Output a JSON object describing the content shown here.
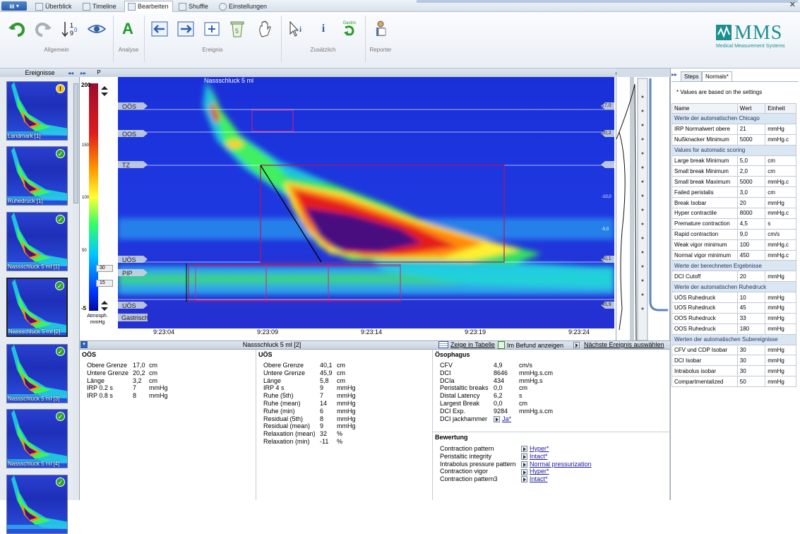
{
  "tabs": [
    "Überblick",
    "Timeline",
    "Bearbeiten",
    "Shuffle",
    "Einstellungen"
  ],
  "active_tab": "Bearbeiten",
  "ribbon": {
    "groups": [
      "Allgemein",
      "Analyse",
      "Ereignis",
      "Zusätzlich",
      "Reporter"
    ],
    "analyse_letter": "A",
    "info_letter": "i",
    "gastric_label": "Gastric"
  },
  "logo": {
    "text": "MMS",
    "subtitle": "Medical Measurement Systems"
  },
  "left_panel": {
    "title": "Ereignisse",
    "thumbs": [
      {
        "label": "Landmark [1]",
        "status": "warn"
      },
      {
        "label": "Ruhedruck [1]",
        "status": "ok"
      },
      {
        "label": "Nassschluck 5 ml [1]",
        "status": "ok"
      },
      {
        "label": "Nassschluck 5 ml [2]",
        "status": "ok"
      },
      {
        "label": "Nassschluck 5 ml [3]",
        "status": "ok"
      },
      {
        "label": "Nassschluck 5 ml [4]",
        "status": "ok"
      },
      {
        "label": "",
        "status": "ok"
      }
    ]
  },
  "colorbar": {
    "header": "P",
    "ticks": [
      "200",
      "150",
      "100",
      "50",
      "0",
      "-5"
    ],
    "unit_line1": "Atmosph.",
    "unit_line2": "mmHg",
    "markers": [
      "30",
      "15"
    ]
  },
  "heatmap": {
    "event_label": "Nassschluck 5 ml",
    "channel_labels": [
      "OÖS",
      "OOS",
      "TZ",
      "UÖS",
      "PIP",
      "UÖS",
      "Gastrisch"
    ],
    "right_values": [
      "17,0",
      "20,2",
      "-10,0",
      "-5,0",
      "40,1",
      "45,9"
    ],
    "time_ticks": [
      "9:23:04",
      "9:23:09",
      "9:23:14",
      "9:23:19",
      "9:23:24"
    ]
  },
  "section_header": {
    "title": "Nassschluck 5 ml [2]",
    "link_table": "Zeige in Tabelle",
    "link_befund": "Im Befund anzeigen",
    "link_next": "Nächste Ereignis auswählen"
  },
  "oos": {
    "title": "OÖS",
    "rows": [
      {
        "label": "Obere Grenze",
        "value": "17,0",
        "unit": "cm"
      },
      {
        "label": "Untere Grenze",
        "value": "20,2",
        "unit": "cm"
      },
      {
        "label": "Länge",
        "value": "3,2",
        "unit": "cm"
      },
      {
        "label": "IRP 0.2 s",
        "value": "7",
        "unit": "mmHg"
      },
      {
        "label": "IRP 0.8 s",
        "value": "8",
        "unit": "mmHg"
      }
    ]
  },
  "uos": {
    "title": "UÖS",
    "rows": [
      {
        "label": "Obere Grenze",
        "value": "40,1",
        "unit": "cm"
      },
      {
        "label": "Untere Grenze",
        "value": "45,9",
        "unit": "cm"
      },
      {
        "label": "Länge",
        "value": "5,8",
        "unit": "cm"
      },
      {
        "label": "IRP 4 s",
        "value": "9",
        "unit": "mmHg"
      },
      {
        "label": "Ruhe (5th)",
        "value": "7",
        "unit": "mmHg"
      },
      {
        "label": "Ruhe (mean)",
        "value": "14",
        "unit": "mmHg"
      },
      {
        "label": "Ruhe (min)",
        "value": "6",
        "unit": "mmHg"
      },
      {
        "label": "Residual (5th)",
        "value": "8",
        "unit": "mmHg"
      },
      {
        "label": "Residual (mean)",
        "value": "9",
        "unit": "mmHg"
      },
      {
        "label": "Relaxation (mean)",
        "value": "32",
        "unit": "%"
      },
      {
        "label": "Relaxation (min)",
        "value": "-11",
        "unit": "%"
      }
    ]
  },
  "oesophagus": {
    "title": "Ösophagus",
    "rows": [
      {
        "label": "CFV",
        "value": "4,9",
        "unit": "cm/s"
      },
      {
        "label": "DCI",
        "value": "8646",
        "unit": "mmHg.s.cm"
      },
      {
        "label": "DCIa",
        "value": "434",
        "unit": "mmHg.s"
      },
      {
        "label": "Peristaltic breaks",
        "value": "0,0",
        "unit": "cm"
      },
      {
        "label": "Distal Latency",
        "value": "6,2",
        "unit": "s"
      },
      {
        "label": "Largest Break",
        "value": "0,0",
        "unit": "cm"
      },
      {
        "label": "DCI Exp.",
        "value": "9284",
        "unit": "mmHg.s.cm"
      },
      {
        "label": "DCI jackhammer",
        "value": "Ja*",
        "unit": ""
      }
    ]
  },
  "bewertung": {
    "title": "Bewertung",
    "rows": [
      {
        "label": "Contraction pattern",
        "value": "Hyper*"
      },
      {
        "label": "Peristaltic integrity",
        "value": "Intact*"
      },
      {
        "label": "Intrabolus pressure pattern",
        "value": "Normal pressurization"
      },
      {
        "label": "Contraction vigor",
        "value": "Hyper*"
      },
      {
        "label": "Contraction pattern3",
        "value": "Intact*"
      }
    ]
  },
  "right_panel": {
    "tabs": [
      "Steps",
      "Normals*"
    ],
    "note": "* Values are based on the settings",
    "headers": [
      "Name",
      "Wert",
      "Einheit"
    ],
    "rows": [
      {
        "section": "Werte der automatischen Chicago"
      },
      {
        "name": "IRP Normalwert obere",
        "value": "21",
        "unit": "mmHg"
      },
      {
        "name": "Nußknacker Minimum",
        "value": "5000",
        "unit": "mmHg.c"
      },
      {
        "section": "Values for automatic scoring"
      },
      {
        "name": "Large break Minimum",
        "value": "5,0",
        "unit": "cm"
      },
      {
        "name": "Small break Minimum",
        "value": "2,0",
        "unit": "cm"
      },
      {
        "name": "Small break Maximum",
        "value": "5000",
        "unit": "mmHg.c"
      },
      {
        "name": "Failed peristalis",
        "value": "3,0",
        "unit": "cm"
      },
      {
        "name": "Break Isobar",
        "value": "20",
        "unit": "mmHg"
      },
      {
        "name": "Hyper contractile",
        "value": "8000",
        "unit": "mmHg.c"
      },
      {
        "name": "Premature contraction",
        "value": "4,5",
        "unit": "s"
      },
      {
        "name": "Rapid contraction",
        "value": "9,0",
        "unit": "cm/s"
      },
      {
        "name": "Weak vigor minimum",
        "value": "100",
        "unit": "mmHg.c"
      },
      {
        "name": "Normal vigor minimum",
        "value": "450",
        "unit": "mmHg.c"
      },
      {
        "section": "Werte der berechneten Ergebnisse"
      },
      {
        "name": "DCI Cutoff",
        "value": "20",
        "unit": "mmHg"
      },
      {
        "section": "Werte der automatischen Ruhedruck"
      },
      {
        "name": "UÖS Ruhedruck",
        "value": "10",
        "unit": "mmHg"
      },
      {
        "name": "UOS Ruhedruck",
        "value": "45",
        "unit": "mmHg"
      },
      {
        "name": "OOS Ruhedruck",
        "value": "33",
        "unit": "mmHg"
      },
      {
        "name": "OOS Ruhedruck",
        "value": "180",
        "unit": "mmHg"
      },
      {
        "section": "Werten der automatischen Subereignisse"
      },
      {
        "name": "CFV und CDP Isobar",
        "value": "30",
        "unit": "mmHg"
      },
      {
        "name": "DCI Isobar",
        "value": "30",
        "unit": "mmHg"
      },
      {
        "name": "Intrabolus isobar",
        "value": "30",
        "unit": "mmHg"
      },
      {
        "name": "Compartmentalized",
        "value": "50",
        "unit": "mmHg"
      }
    ]
  }
}
